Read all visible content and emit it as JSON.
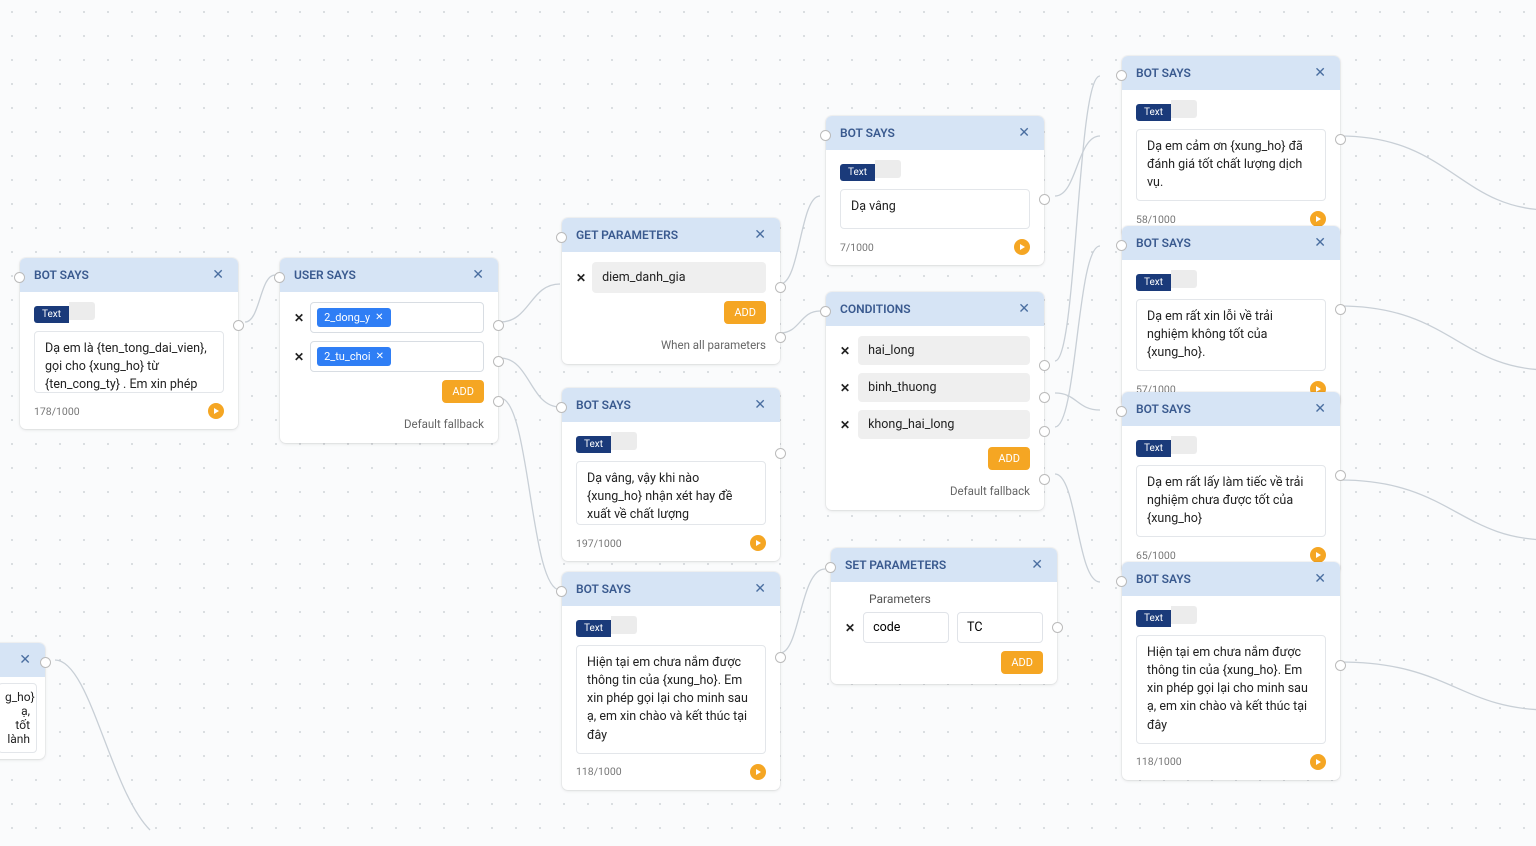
{
  "columns": {
    "col1": {
      "botSays1": {
        "title": "BOT SAYS",
        "textTab": "Text",
        "body": "Dạ em là {ten_tong_dai_vien}, gọi cho {xung_ho} từ {ten_cong_ty} . Em xin phép trao đổi với mình một vài phút về chất lượng dịch vụ {ten_san_pham_dich_vu} của bên em được",
        "count": "178/1000"
      },
      "partial": {
        "line1": "g_ho} ạ,",
        "line2": "tốt lành"
      }
    },
    "col2": {
      "userSays": {
        "title": "USER SAYS",
        "tokens": [
          "2_dong_y",
          "2_tu_choi"
        ],
        "addLabel": "ADD",
        "hint": "Default fallback"
      }
    },
    "col3": {
      "getParams": {
        "title": "GET PARAMETERS",
        "param": "diem_danh_gia",
        "addLabel": "ADD",
        "hint": "When all parameters"
      },
      "botSays2": {
        "title": "BOT SAYS",
        "textTab": "Text",
        "body": "Dạ vâng, vậy khi nào {xung_ho} nhận xét hay đề xuất về chất lượng {ten_san_pham_dich_vu}, {xung_ho} có thể gửi yêu cầu hoặc gọi lên hệ thống giúp em.",
        "count": "197/1000"
      },
      "botSays3": {
        "title": "BOT SAYS",
        "textTab": "Text",
        "body": "Hiện tại em chưa nắm được thông tin của {xung_ho}. Em xin phép gọi lại cho minh sau ạ, em xin chào và kết thúc tại đây",
        "count": "118/1000"
      }
    },
    "col4": {
      "botSays4": {
        "title": "BOT SAYS",
        "textTab": "Text",
        "body": "Dạ vâng",
        "count": "7/1000"
      },
      "conditions": {
        "title": "CONDITIONS",
        "items": [
          "hai_long",
          "binh_thuong",
          "khong_hai_long"
        ],
        "addLabel": "ADD",
        "hint": "Default fallback"
      },
      "setParams": {
        "title": "SET PARAMETERS",
        "paramHead": "Parameters",
        "key": "code",
        "value": "TC",
        "addLabel": "ADD"
      }
    },
    "col5": {
      "botA": {
        "title": "BOT SAYS",
        "textTab": "Text",
        "body": "Dạ em cảm ơn {xung_ho} đã đánh giá tốt chất lượng dịch vụ.",
        "count": "58/1000"
      },
      "botB": {
        "title": "BOT SAYS",
        "textTab": "Text",
        "body": "Dạ em rất xin lỗi về trải nghiệm không tốt của {xung_ho}.",
        "count": "57/1000"
      },
      "botC": {
        "title": "BOT SAYS",
        "textTab": "Text",
        "body": "Dạ em rất lấy làm tiếc về trải nghiệm chưa được tốt của {xung_ho}",
        "count": "65/1000"
      },
      "botD": {
        "title": "BOT SAYS",
        "textTab": "Text",
        "body": "Hiện tại em chưa nắm được thông tin của {xung_ho}. Em xin phép gọi lại cho minh sau ạ, em xin chào và kết thúc tại đây",
        "count": "118/1000"
      }
    }
  }
}
